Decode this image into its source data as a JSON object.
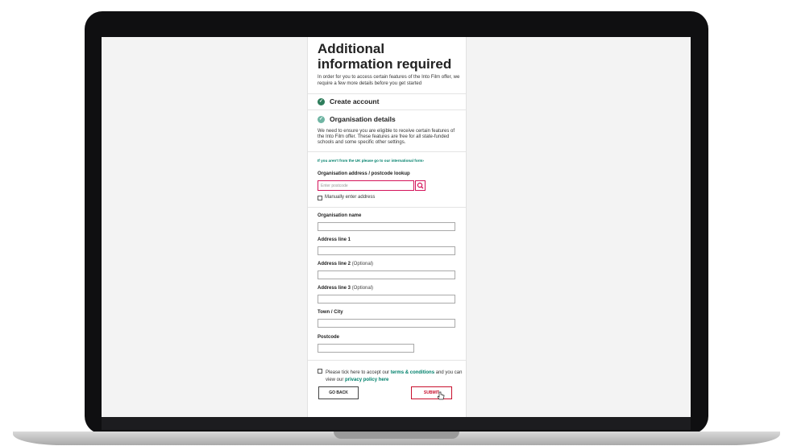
{
  "form": {
    "title": "Additional information required",
    "intro": "In order for you to access certain features of the Into Film offer, we require a few more details before you get started",
    "step1": "Create account",
    "step2": "Organisation details",
    "org_desc": "We need to ensure you are eligible to receive certain features of the Into Film offer. These features are free for all state-funded schools and some specific other settings.",
    "intl_link": "If you aren't from the UK please go to our international form›",
    "lookup_label": "Organisation address / postcode lookup",
    "postcode_placeholder": "Enter postcode",
    "manual_label": "Manually enter address",
    "org_name_label": "Organisation name",
    "addr1_label": "Address line 1",
    "addr2_label": "Address line 2",
    "addr3_label": "Address line 3",
    "optional": "(Optional)",
    "town_label": "Town / City",
    "postcode_label": "Postcode",
    "terms_pre": "Please tick here to accept our",
    "terms_link": "terms & conditions",
    "terms_mid": "and you can view our",
    "privacy_link": "privacy policy here",
    "back_label": "GO BACK",
    "submit_label": "SUBMIT"
  },
  "colors": {
    "accent": "#00806b",
    "check_done": "#2e7d5b",
    "check_current": "#6fb5a3",
    "error": "#d4145a"
  }
}
